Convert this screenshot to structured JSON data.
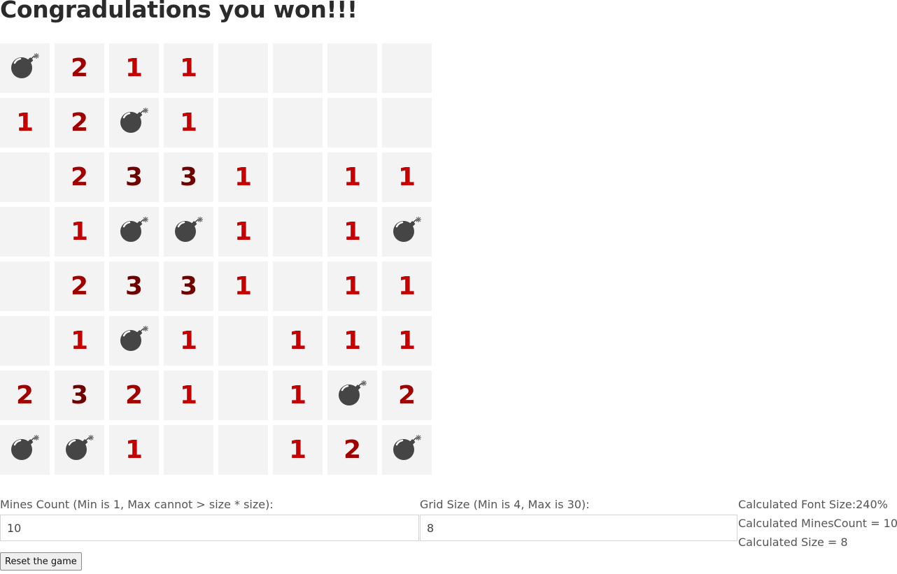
{
  "title": "Congradulations you won!!!",
  "board": {
    "size": 8,
    "rows": [
      [
        "bomb",
        "2",
        "1",
        "1",
        "",
        "",
        "",
        ""
      ],
      [
        "1",
        "2",
        "bomb",
        "1",
        "",
        "",
        "",
        ""
      ],
      [
        "",
        "2",
        "3",
        "3",
        "1",
        "",
        "1",
        "1"
      ],
      [
        "",
        "1",
        "bomb",
        "bomb",
        "1",
        "",
        "1",
        "bomb"
      ],
      [
        "",
        "2",
        "3",
        "3",
        "1",
        "",
        "1",
        "1"
      ],
      [
        "",
        "1",
        "bomb",
        "1",
        "",
        "1",
        "1",
        "1"
      ],
      [
        "2",
        "3",
        "2",
        "1",
        "",
        "1",
        "bomb",
        "2"
      ],
      [
        "bomb",
        "bomb",
        "1",
        "",
        "",
        "1",
        "2",
        "bomb"
      ]
    ],
    "colors": {
      "cell_bg": "#f3f3f3",
      "number_1": "#c40000",
      "number_2": "#a00000",
      "number_3": "#6e0000",
      "bomb": "#454545"
    },
    "bomb_icon": "bomb-icon"
  },
  "controls": {
    "mines_label": "Mines Count (Min is 1, Max cannot > size * size):",
    "mines_value": "10",
    "size_label": "Grid Size (Min is 4, Max is 30):",
    "size_value": "8",
    "calc_font": "Calculated Font Size:240%",
    "calc_mines": "Calculated MinesCount = 10",
    "calc_size": "Calculated Size = 8",
    "reset_label": "Reset the game"
  }
}
